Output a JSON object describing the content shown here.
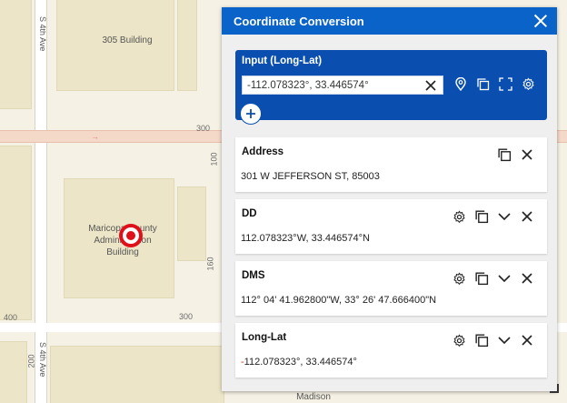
{
  "map": {
    "buildings": {
      "top": "305 Building",
      "main_line1": "Maricopa County",
      "main_line2": "Administration",
      "main_line3": "Building",
      "bottom": "Madison"
    },
    "streets": {
      "upper": "S 4th Ave",
      "lower": "S 4th Ave"
    },
    "numbers": {
      "n300_right": "300",
      "n300_bottom": "300",
      "n400": "400",
      "n100": "100",
      "n160": "160",
      "n200": "200"
    }
  },
  "panel": {
    "title": "Coordinate Conversion",
    "input": {
      "label": "Input (Long-Lat)",
      "value": "-112.078323°, 33.446574°"
    },
    "cards": [
      {
        "title": "Address",
        "value": "301 W JEFFERSON ST, 85003"
      },
      {
        "title": "DD",
        "value": "112.078323°W, 33.446574°N"
      },
      {
        "title": "DMS",
        "value": "112° 04' 41.962800\"W, 33° 26' 47.666400\"N"
      },
      {
        "title": "Long-Lat",
        "value_prefix": "-",
        "value": "112.078323°, 33.446574°"
      }
    ]
  },
  "icons": {
    "close": "close-icon",
    "clear": "clear-icon",
    "pin": "map-pin-icon",
    "copy": "copy-icon",
    "expand": "expand-icon",
    "settings": "gear-icon",
    "chevron": "chevron-down-icon",
    "add": "plus-icon"
  },
  "colors": {
    "header": "#0a63c9",
    "input_card": "#0a4fb0",
    "marker": "#e0101a"
  }
}
